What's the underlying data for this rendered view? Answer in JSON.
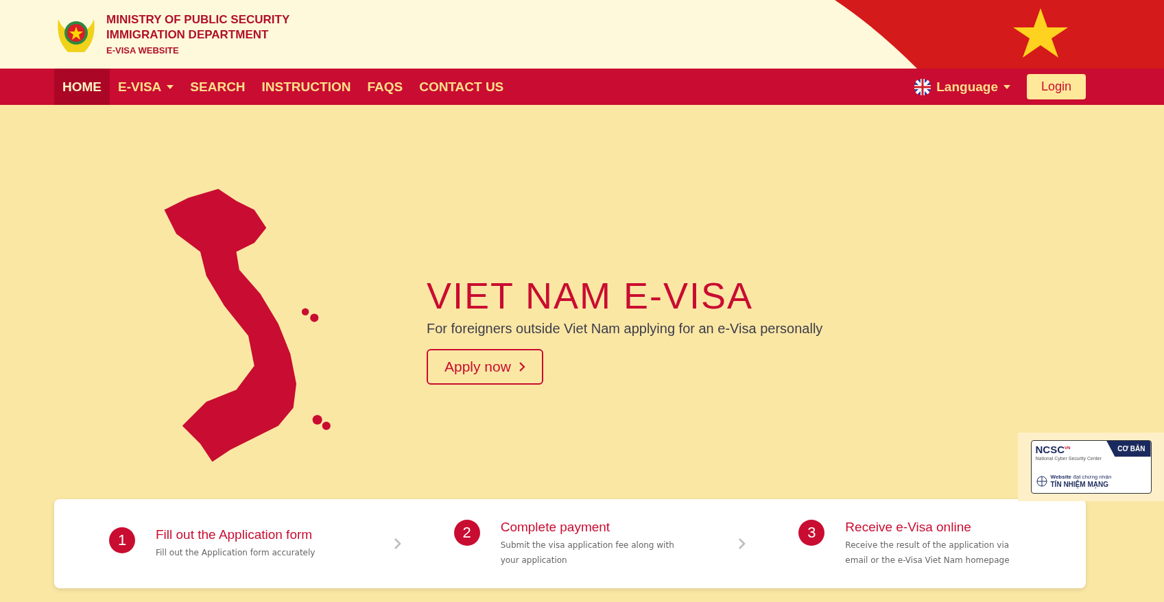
{
  "header": {
    "lines": [
      "MINISTRY OF PUBLIC SECURITY",
      "IMMIGRATION DEPARTMENT",
      "E-VISA WEBSITE"
    ]
  },
  "nav": {
    "items": [
      {
        "label": "HOME",
        "selected": true,
        "dropdown": false
      },
      {
        "label": "E-VISA",
        "selected": false,
        "dropdown": true
      },
      {
        "label": "SEARCH",
        "selected": false,
        "dropdown": false
      },
      {
        "label": "INSTRUCTION",
        "selected": false,
        "dropdown": false
      },
      {
        "label": "FAQS",
        "selected": false,
        "dropdown": false
      },
      {
        "label": "CONTACT US",
        "selected": false,
        "dropdown": false
      }
    ],
    "language": "Language",
    "login": "Login"
  },
  "hero": {
    "title": "VIET NAM E-VISA",
    "subtitle": "For foreigners outside Viet Nam applying for an e-Visa personally",
    "button": "Apply now"
  },
  "badge": {
    "brand": "NCSC",
    "country": "VN",
    "org": "National Cyber Security Center",
    "level": "CƠ BẢN",
    "line1_bold": "Website",
    "line1": "đạt chứng nhận",
    "line2": "TÍN NHIỆM MẠNG"
  },
  "steps": [
    {
      "number": "1",
      "title": "Fill out the Application form",
      "text": "Fill out the Application form accurately"
    },
    {
      "number": "2",
      "title": "Complete payment",
      "text": "Submit the visa application fee along with your application"
    },
    {
      "number": "3",
      "title": "Receive e-Visa online",
      "text": "Receive the result of the application via email or the e-Visa Viet Nam homepage"
    }
  ]
}
